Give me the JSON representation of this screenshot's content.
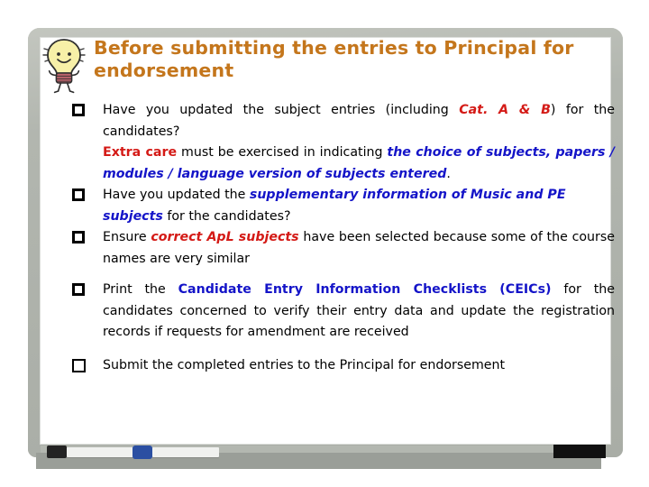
{
  "slide": {
    "icon": "lightbulb-idea-icon",
    "title": "Before submitting the entries to Principal for endorsement",
    "title_color": "#c4761c",
    "accent_red": "#d41a16",
    "accent_blue": "#1414c8",
    "board_frame_color": "#b3b7b0",
    "board_tray_color": "#9a9e98"
  },
  "checklist": {
    "items": [
      {
        "id": "item-update-subject-entries",
        "checkbox": "unchecked",
        "segments": [
          {
            "text": "Have you updated the subject entries (including ",
            "style": "plain"
          },
          {
            "text": "Cat. A & B",
            "style": "red"
          },
          {
            "text": ") for the candidates?",
            "style": "plain"
          }
        ],
        "plain_text": "Have you updated the subject entries (including Cat. A & B) for the candidates?"
      },
      {
        "id": "item-extra-care-note",
        "checkbox": "none",
        "segments": [
          {
            "text": "Extra care",
            "style": "red"
          },
          {
            "text": " must be exercised in indicating ",
            "style": "plain"
          },
          {
            "text": "the choice of subjects, papers / modules / language version of subjects entered",
            "style": "blue"
          },
          {
            "text": ".",
            "style": "plain"
          }
        ],
        "plain_text": "Extra care must be exercised in indicating the choice of subjects, papers / modules / language version of subjects entered."
      },
      {
        "id": "item-supplementary-music-pe",
        "checkbox": "unchecked",
        "segments": [
          {
            "text": "Have you updated the ",
            "style": "plain"
          },
          {
            "text": "supplementary information of Music and PE subjects",
            "style": "blue"
          },
          {
            "text": " for the candidates?",
            "style": "plain"
          }
        ],
        "plain_text": "Have you updated the supplementary information of Music and PE subjects for the candidates?"
      },
      {
        "id": "item-correct-apl-subjects",
        "checkbox": "unchecked",
        "segments": [
          {
            "text": "Ensure ",
            "style": "plain"
          },
          {
            "text": "correct ApL subjects",
            "style": "red"
          },
          {
            "text": " have been selected because some of the course names are very similar",
            "style": "plain"
          }
        ],
        "plain_text": "Ensure correct ApL subjects have been selected because some of the course names are very similar"
      },
      {
        "id": "item-print-ceics",
        "checkbox": "unchecked",
        "segments": [
          {
            "text": "Print the ",
            "style": "plain"
          },
          {
            "text": "Candidate Entry Information Checklists (CEICs)",
            "style": "blue-upright"
          },
          {
            "text": " for the candidates concerned to verify their entry data and update the registration records if requests for amendment are received",
            "style": "plain"
          }
        ],
        "plain_text": "Print the Candidate Entry Information Checklists (CEICs) for the candidates concerned to verify their entry data and update the registration records if requests for amendment are received"
      },
      {
        "id": "item-submit-entries",
        "checkbox": "unchecked",
        "segments": [
          {
            "text": "Submit the completed entries to the Principal for endorsement",
            "style": "plain"
          }
        ],
        "plain_text": "Submit the completed entries to the Principal for endorsement"
      }
    ]
  },
  "tray": {
    "marker_black_label": "black-marker",
    "marker_blue_label": "blue-marker",
    "eraser_label": "whiteboard-eraser"
  }
}
